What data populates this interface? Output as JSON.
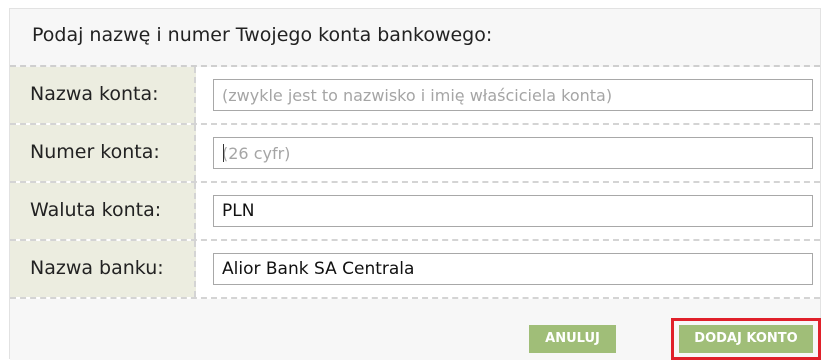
{
  "dialog": {
    "title": "Podaj nazwę i numer Twojego konta bankowego:"
  },
  "form": {
    "account_name": {
      "label": "Nazwa konta:",
      "value": "",
      "placeholder": "(zwykle jest to nazwisko i imię właściciela konta)"
    },
    "account_number": {
      "label": "Numer konta:",
      "value": "",
      "placeholder": "(26 cyfr)"
    },
    "account_currency": {
      "label": "Waluta konta:",
      "value": "PLN",
      "placeholder": ""
    },
    "bank_name": {
      "label": "Nazwa banku:",
      "value": "Alior Bank SA Centrala",
      "placeholder": ""
    }
  },
  "buttons": {
    "cancel_label": "ANULUJ",
    "add_account_label": "DODAJ KONTO"
  },
  "colors": {
    "button_green": "#a0be78",
    "label_cell_bg": "#ecede0",
    "highlight_red": "#e0202a"
  }
}
